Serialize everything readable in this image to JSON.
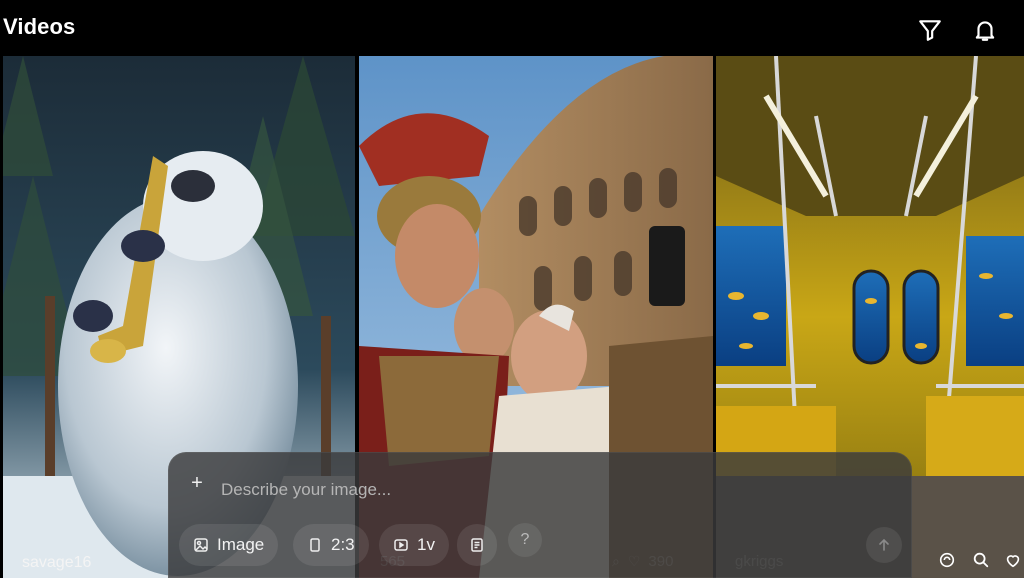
{
  "header": {
    "title": "Videos",
    "filter_icon": "filter-icon",
    "bell_icon": "bell-icon"
  },
  "tiles": [
    {
      "user": "savage16",
      "subject": "yeti playing saxophone in snowy forest"
    },
    {
      "count": "565",
      "likes": "390",
      "subject": "roman soldiers selfie at colosseum"
    },
    {
      "user": "gkriggs",
      "subject": "underwater submarine train interior"
    }
  ],
  "composer": {
    "placeholder": "Describe your image...",
    "add_icon": "plus-icon",
    "chips": {
      "mode": "Image",
      "ratio": "2:3",
      "count": "1v"
    },
    "help_label": "?",
    "send_icon": "arrow-up-icon"
  },
  "colors": {
    "background": "#000000",
    "composer": "#3a3a3c",
    "text": "#ffffff"
  }
}
